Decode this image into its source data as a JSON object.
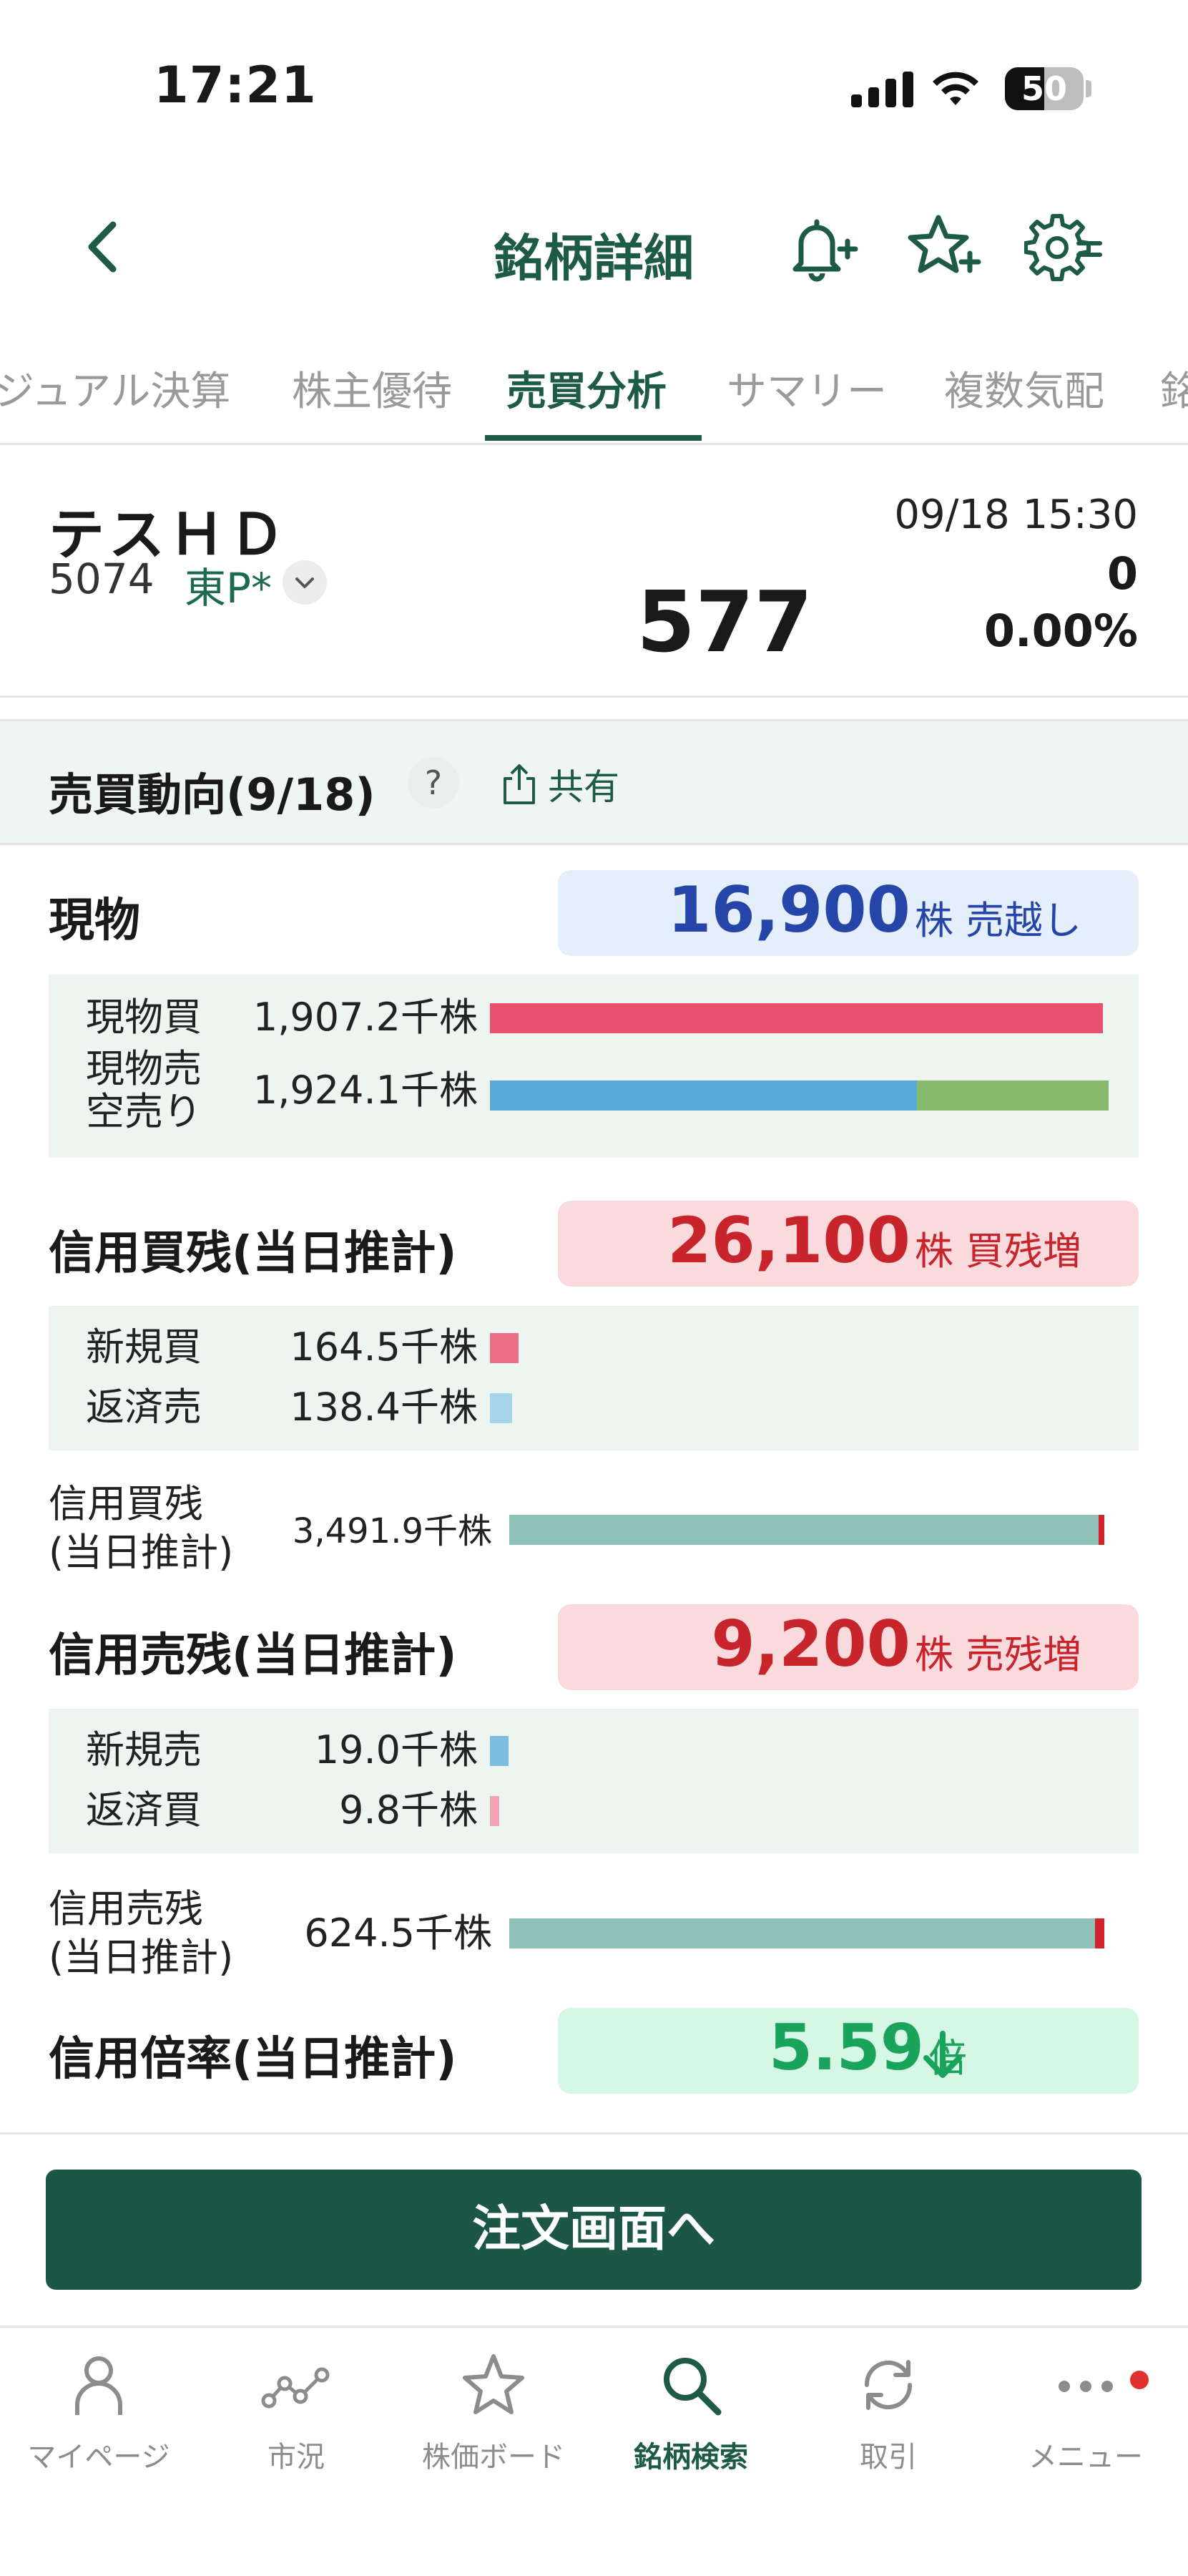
{
  "status_bar": {
    "time": "17:21",
    "battery": "50",
    "battery_level": 0.5
  },
  "header": {
    "title": "銘柄詳細"
  },
  "tabs": [
    {
      "label": "ジュアル決算"
    },
    {
      "label": "株主優待"
    },
    {
      "label": "売買分析",
      "active": true
    },
    {
      "label": "サマリー"
    },
    {
      "label": "複数気配"
    },
    {
      "label": "銘"
    }
  ],
  "stock": {
    "name": "テスＨＤ",
    "code": "5074",
    "market": "東P*",
    "price": "577",
    "datetime": "09/18 15:30",
    "change": "0",
    "change_pct": "0.00%"
  },
  "trend": {
    "title": "売買動向(9/18)",
    "help": "?",
    "share": "共有",
    "spot": {
      "title": "現物",
      "value": "16,900",
      "unit": "株 売越し",
      "rows": [
        {
          "label": "現物買",
          "value": "1,907.2千株",
          "bar_fraction": 0.985,
          "short_fraction": 0
        },
        {
          "label_line1": "現物売",
          "label_line2": "空売り",
          "value": "1,924.1千株",
          "bar_fraction": 0.994,
          "short_fraction": 0.31
        }
      ]
    },
    "margin_buy": {
      "title": "信用買残(当日推計)",
      "value": "26,100",
      "unit": "株 買残増",
      "rows": [
        {
          "label": "新規買",
          "value": "164.5千株",
          "bar_fraction": 0.046
        },
        {
          "label": "返済売",
          "value": "138.4千株",
          "bar_fraction": 0.036
        }
      ],
      "balance": {
        "label_line1": "信用買残",
        "label_line2": "(当日推計)",
        "value": "3,491.9千株",
        "bar_fraction": 0.99,
        "increase_fraction": 0.0075
      }
    },
    "margin_sell": {
      "title": "信用売残(当日推計)",
      "value": "9,200",
      "unit": "株 売残増",
      "rows": [
        {
          "label": "新規売",
          "value": "19.0千株",
          "bar_fraction": 0.03
        },
        {
          "label": "返済買",
          "value": "9.8千株",
          "bar_fraction": 0.015
        }
      ],
      "balance": {
        "label_line1": "信用売残",
        "label_line2": "(当日推計)",
        "value": "624.5千株",
        "bar_fraction": 0.99,
        "increase_fraction": 0.015
      }
    },
    "ratio": {
      "title": "信用倍率(当日推計)",
      "value": "5.59",
      "unit": "倍"
    }
  },
  "order_button": "注文画面へ",
  "bottom_nav": [
    {
      "label": "マイページ",
      "icon": "person-icon"
    },
    {
      "label": "市況",
      "icon": "market-chart-icon"
    },
    {
      "label": "株価ボード",
      "icon": "star-icon"
    },
    {
      "label": "銘柄検索",
      "icon": "search-icon",
      "active": true
    },
    {
      "label": "取引",
      "icon": "refresh-icon"
    },
    {
      "label": "メニュー",
      "icon": "more-icon"
    }
  ],
  "colors": {
    "brand": "#1e5a48",
    "buy_bar": "#e8526e",
    "sell_bar": "#5aa8d6",
    "short_bar": "#86b96b",
    "balance_bar": "#8ec2b6",
    "increase_mark": "#d2232a",
    "new_buy": "#ec6f86",
    "repay_sell": "#a6d4ea",
    "new_sell": "#7dbde0",
    "repay_buy": "#f2a3b1"
  }
}
